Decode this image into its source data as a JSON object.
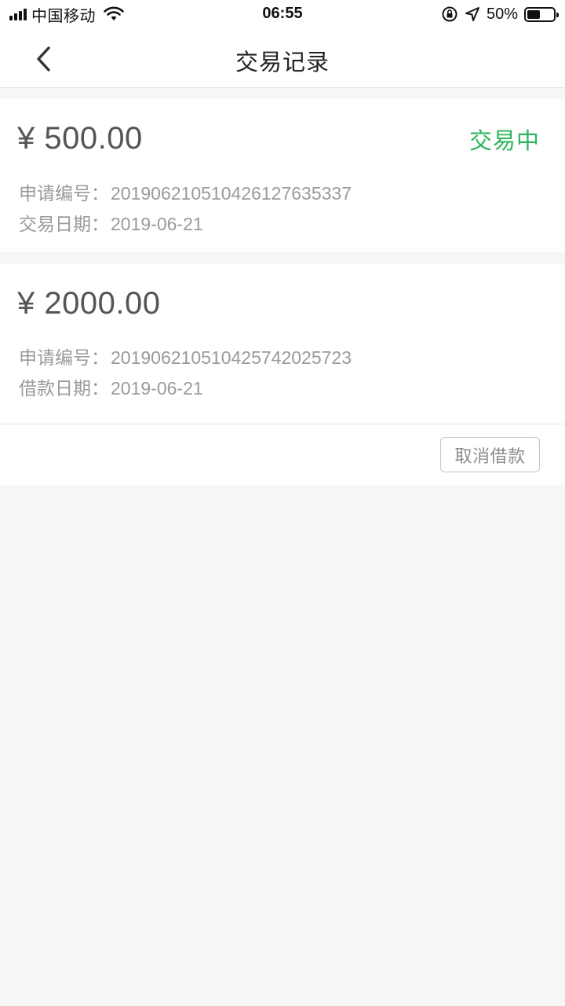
{
  "status_bar": {
    "carrier": "中国移动",
    "time": "06:55",
    "battery_percent": "50%",
    "battery_level": 0.5
  },
  "header": {
    "title": "交易记录",
    "back_icon": "chevron-left-icon"
  },
  "records": [
    {
      "amount": "¥ 500.00",
      "status": "交易中",
      "status_color": "#2bb55a",
      "lines": [
        {
          "label": "申请编号：",
          "value": "20190621051042612763533​7"
        },
        {
          "label": "交易日期：",
          "value": "2019-06-21"
        }
      ]
    },
    {
      "amount": "¥ 2000.00",
      "lines": [
        {
          "label": "申请编号：",
          "value": "20190621051042574202572​3"
        },
        {
          "label": "借款日期：",
          "value": "2019-06-21"
        }
      ],
      "action_label": "取消借款"
    }
  ]
}
